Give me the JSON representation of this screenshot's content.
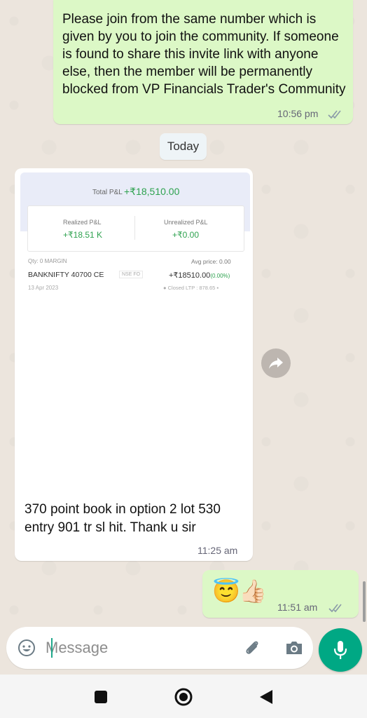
{
  "messages": {
    "top": {
      "text": "Please join from the same number which is given by you to join the community. If someone is found to share this invite link with anyone else, then the member will be permanently blocked from VP Financials Trader's Community",
      "time": "10:56 pm"
    },
    "day_divider": "Today",
    "card": {
      "total_label": "Total P&L",
      "total_value": "+₹18,510.00",
      "realized_label": "Realized P&L",
      "realized_value": "+₹18.51 K",
      "unrealized_label": "Unrealized P&L",
      "unrealized_value": "+₹0.00",
      "qty": "Qty: 0  MARGIN",
      "instrument": "BANKNIFTY 40700 CE",
      "exchange": "NSE FO",
      "date": "13 Apr 2023",
      "avg_price": "Avg price: 0.00",
      "pnl": "+₹18510.00",
      "pnl_pct": "(0.00%)",
      "status": "● Closed  LTP : 878.65 ▪",
      "caption": "370 point book in option 2 lot 530 entry 901 tr sl hit. Thank u sir",
      "time": "11:25 am"
    },
    "emoji_msg": {
      "emoji_1": "😇",
      "emoji_2": "👍🏻",
      "time": "11:51 am"
    }
  },
  "composer": {
    "placeholder": "Message"
  },
  "colors": {
    "outgoing_bubble": "#dcf8c6",
    "incoming_bubble": "#ffffff",
    "accent": "#00a884",
    "profit_green": "#2ea24f",
    "read_ticks": "#8a9aa8"
  }
}
